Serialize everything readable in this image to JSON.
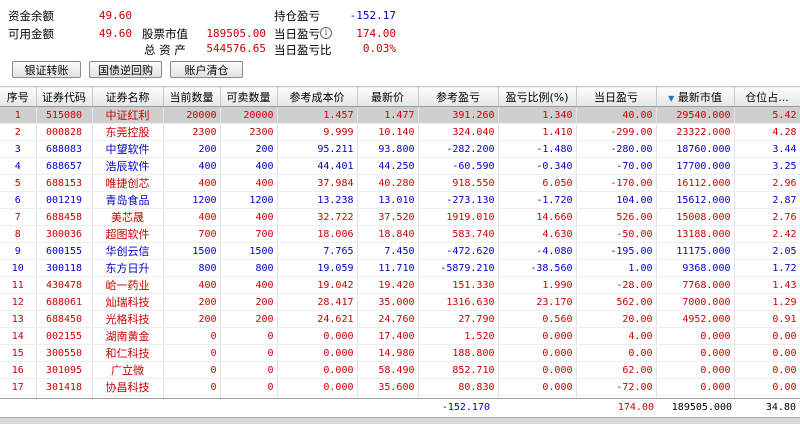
{
  "summary": {
    "cash_balance_label": "资金余额",
    "cash_balance": "49.60",
    "available_label": "可用金额",
    "available": "49.60",
    "stock_value_label": "股票市值",
    "stock_value": "189505.00",
    "total_assets_label": "总 资 产",
    "total_assets": "544576.65",
    "position_pl_label": "持仓盈亏",
    "position_pl": "-152.17",
    "daily_pl_label": "当日盈亏",
    "daily_pl": "174.00",
    "daily_pl_ratio_label": "当日盈亏比",
    "daily_pl_ratio": "0.03%"
  },
  "buttons": {
    "transfer": "银证转账",
    "repo": "国债逆回购",
    "clear": "账户清仓"
  },
  "columns": [
    "序号",
    "证券代码",
    "证券名称",
    "当前数量",
    "可卖数量",
    "参考成本价",
    "最新价",
    "参考盈亏",
    "盈亏比例(%)",
    "当日盈亏",
    "最新市值",
    "仓位占..."
  ],
  "rows": [
    {
      "no": "1",
      "code": "515080",
      "name": "中证红利",
      "qty": "20000",
      "avail": "20000",
      "cost": "1.457",
      "price": "1.477",
      "pl": "391.260",
      "plr": "1.340",
      "dpl": "40.00",
      "mv": "29540.000",
      "pos": "5.42",
      "color": "red",
      "selected": true
    },
    {
      "no": "2",
      "code": "000828",
      "name": "东莞控股",
      "qty": "2300",
      "avail": "2300",
      "cost": "9.999",
      "price": "10.140",
      "pl": "324.040",
      "plr": "1.410",
      "dpl": "-299.00",
      "mv": "23322.000",
      "pos": "4.28",
      "color": "red",
      "selected": false
    },
    {
      "no": "3",
      "code": "688083",
      "name": "中望软件",
      "qty": "200",
      "avail": "200",
      "cost": "95.211",
      "price": "93.800",
      "pl": "-282.200",
      "plr": "-1.480",
      "dpl": "-280.00",
      "mv": "18760.000",
      "pos": "3.44",
      "color": "blue",
      "selected": false
    },
    {
      "no": "4",
      "code": "688657",
      "name": "浩辰软件",
      "qty": "400",
      "avail": "400",
      "cost": "44.401",
      "price": "44.250",
      "pl": "-60.590",
      "plr": "-0.340",
      "dpl": "-70.00",
      "mv": "17700.000",
      "pos": "3.25",
      "color": "blue",
      "selected": false
    },
    {
      "no": "5",
      "code": "688153",
      "name": "唯捷创芯",
      "qty": "400",
      "avail": "400",
      "cost": "37.984",
      "price": "40.280",
      "pl": "918.550",
      "plr": "6.050",
      "dpl": "-170.00",
      "mv": "16112.000",
      "pos": "2.96",
      "color": "red",
      "selected": false
    },
    {
      "no": "6",
      "code": "001219",
      "name": "青岛食品",
      "qty": "1200",
      "avail": "1200",
      "cost": "13.238",
      "price": "13.010",
      "pl": "-273.130",
      "plr": "-1.720",
      "dpl": "104.00",
      "mv": "15612.000",
      "pos": "2.87",
      "color": "blue",
      "selected": false
    },
    {
      "no": "7",
      "code": "688458",
      "name": "美芯晟",
      "qty": "400",
      "avail": "400",
      "cost": "32.722",
      "price": "37.520",
      "pl": "1919.010",
      "plr": "14.660",
      "dpl": "526.00",
      "mv": "15008.000",
      "pos": "2.76",
      "color": "red",
      "selected": false
    },
    {
      "no": "8",
      "code": "300036",
      "name": "超图软件",
      "qty": "700",
      "avail": "700",
      "cost": "18.006",
      "price": "18.840",
      "pl": "583.740",
      "plr": "4.630",
      "dpl": "-50.00",
      "mv": "13188.000",
      "pos": "2.42",
      "color": "red",
      "selected": false
    },
    {
      "no": "9",
      "code": "600155",
      "name": "华创云信",
      "qty": "1500",
      "avail": "1500",
      "cost": "7.765",
      "price": "7.450",
      "pl": "-472.620",
      "plr": "-4.080",
      "dpl": "-195.00",
      "mv": "11175.000",
      "pos": "2.05",
      "color": "blue",
      "selected": false
    },
    {
      "no": "10",
      "code": "300118",
      "name": "东方日升",
      "qty": "800",
      "avail": "800",
      "cost": "19.059",
      "price": "11.710",
      "pl": "-5879.210",
      "plr": "-38.560",
      "dpl": "1.00",
      "mv": "9368.000",
      "pos": "1.72",
      "color": "blue",
      "selected": false
    },
    {
      "no": "11",
      "code": "430478",
      "name": "峆一药业",
      "qty": "400",
      "avail": "400",
      "cost": "19.042",
      "price": "19.420",
      "pl": "151.330",
      "plr": "1.990",
      "dpl": "-28.00",
      "mv": "7768.000",
      "pos": "1.43",
      "color": "red",
      "selected": false
    },
    {
      "no": "12",
      "code": "688061",
      "name": "灿瑞科技",
      "qty": "200",
      "avail": "200",
      "cost": "28.417",
      "price": "35.000",
      "pl": "1316.630",
      "plr": "23.170",
      "dpl": "562.00",
      "mv": "7000.000",
      "pos": "1.29",
      "color": "red",
      "selected": false
    },
    {
      "no": "13",
      "code": "688450",
      "name": "光格科技",
      "qty": "200",
      "avail": "200",
      "cost": "24.621",
      "price": "24.760",
      "pl": "27.790",
      "plr": "0.560",
      "dpl": "20.00",
      "mv": "4952.000",
      "pos": "0.91",
      "color": "red",
      "selected": false
    },
    {
      "no": "14",
      "code": "002155",
      "name": "湖南黄金",
      "qty": "0",
      "avail": "0",
      "cost": "0.000",
      "price": "17.400",
      "pl": "1.520",
      "plr": "0.000",
      "dpl": "4.00",
      "mv": "0.000",
      "pos": "0.00",
      "color": "red",
      "selected": false
    },
    {
      "no": "15",
      "code": "300550",
      "name": "和仁科技",
      "qty": "0",
      "avail": "0",
      "cost": "0.000",
      "price": "14.980",
      "pl": "188.800",
      "plr": "0.000",
      "dpl": "0.00",
      "mv": "0.000",
      "pos": "0.00",
      "color": "red",
      "selected": false
    },
    {
      "no": "16",
      "code": "301095",
      "name": "广立微",
      "qty": "0",
      "avail": "0",
      "cost": "0.000",
      "price": "58.490",
      "pl": "852.710",
      "plr": "0.000",
      "dpl": "62.00",
      "mv": "0.000",
      "pos": "0.00",
      "color": "red",
      "selected": false
    },
    {
      "no": "17",
      "code": "301418",
      "name": "协昌科技",
      "qty": "0",
      "avail": "0",
      "cost": "0.000",
      "price": "35.600",
      "pl": "80.830",
      "plr": "0.000",
      "dpl": "-72.00",
      "mv": "0.000",
      "pos": "0.00",
      "color": "red",
      "selected": false
    },
    {
      "no": "18",
      "code": "600446",
      "name": "金证股份",
      "qty": "0",
      "avail": "0",
      "cost": "0.000",
      "price": "17.990",
      "pl": "59.370",
      "plr": "0.000",
      "dpl": "22.00",
      "mv": "0.000",
      "pos": "0.00",
      "color": "red",
      "selected": false
    }
  ],
  "totals": {
    "pl": "-152.170",
    "dpl": "174.00",
    "mv": "189505.000",
    "pos": "34.80"
  },
  "colors": {
    "gain": "#cc0000",
    "loss": "#0000cc",
    "selected_row": "#cfcfcf"
  },
  "sort_icon": "sort-desc-icon"
}
